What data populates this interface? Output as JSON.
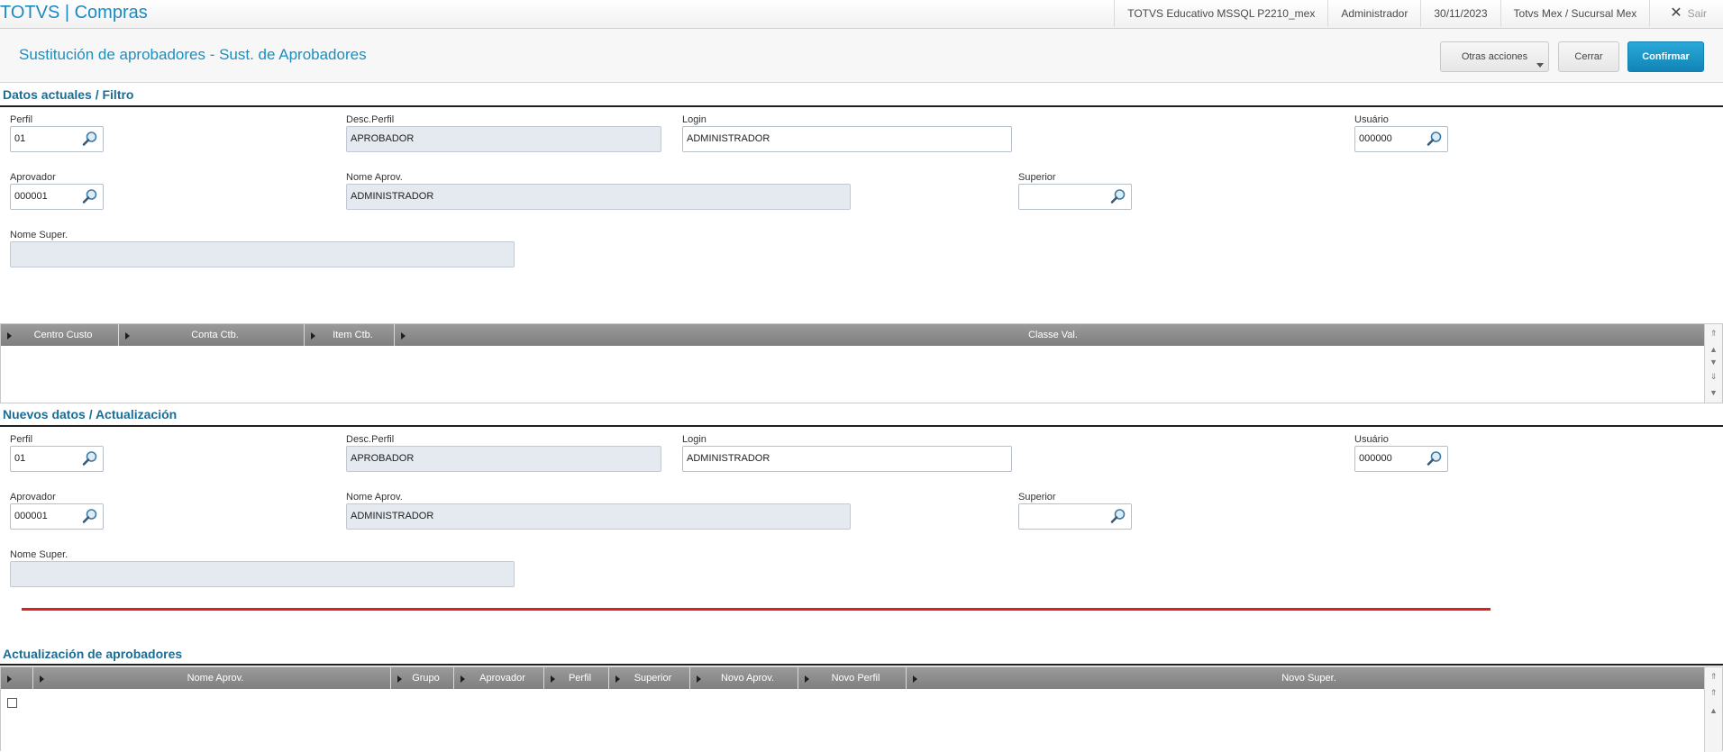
{
  "topbar": {
    "app_title": "TOTVS | Compras",
    "environment": "TOTVS Educativo MSSQL P2210_mex",
    "user": "Administrador",
    "date": "30/11/2023",
    "branch": "Totvs Mex / Sucursal Mex",
    "exit_label": "Sair"
  },
  "header": {
    "title": "Sustitución de aprobadores - Sust. de Aprobadores",
    "other_actions_label": "Otras acciones",
    "close_label": "Cerrar",
    "confirm_label": "Confirmar"
  },
  "filter": {
    "section_title": "Datos actuales / Filtro",
    "perfil_label": "Perfil",
    "perfil_value": "01",
    "desc_perfil_label": "Desc.Perfil",
    "desc_perfil_value": "APROBADOR",
    "login_label": "Login",
    "login_value": "ADMINISTRADOR",
    "usuario_label": "Usuário",
    "usuario_value": "000000",
    "aprovador_label": "Aprovador",
    "aprovador_value": "000001",
    "nome_aprov_label": "Nome Aprov.",
    "nome_aprov_value": "ADMINISTRADOR",
    "superior_label": "Superior",
    "superior_value": "",
    "nome_super_label": "Nome Super.",
    "nome_super_value": "",
    "grid_columns": [
      "Centro Custo",
      "Conta Ctb.",
      "Item Ctb.",
      "Classe Val."
    ]
  },
  "update": {
    "section_title": "Nuevos datos / Actualización",
    "perfil_label": "Perfil",
    "perfil_value": "01",
    "desc_perfil_label": "Desc.Perfil",
    "desc_perfil_value": "APROBADOR",
    "login_label": "Login",
    "login_value": "ADMINISTRADOR",
    "usuario_label": "Usuário",
    "usuario_value": "000000",
    "aprovador_label": "Aprovador",
    "aprovador_value": "000001",
    "nome_aprov_label": "Nome Aprov.",
    "nome_aprov_value": "ADMINISTRADOR",
    "superior_label": "Superior",
    "superior_value": "",
    "nome_super_label": "Nome Super.",
    "nome_super_value": ""
  },
  "approvers": {
    "section_title": "Actualización de aprobadores",
    "grid_columns": [
      "",
      "Nome Aprov.",
      "Grupo",
      "Aprovador",
      "Perfil",
      "Superior",
      "Novo Aprov.",
      "Novo Perfil",
      "Novo Super."
    ]
  },
  "colors": {
    "accent": "#1a8ac2",
    "confirm": "#1a97c9",
    "section_title": "#1a6e96",
    "readonly_fill": "#e5e9f0",
    "divider_red": "#e02020"
  }
}
